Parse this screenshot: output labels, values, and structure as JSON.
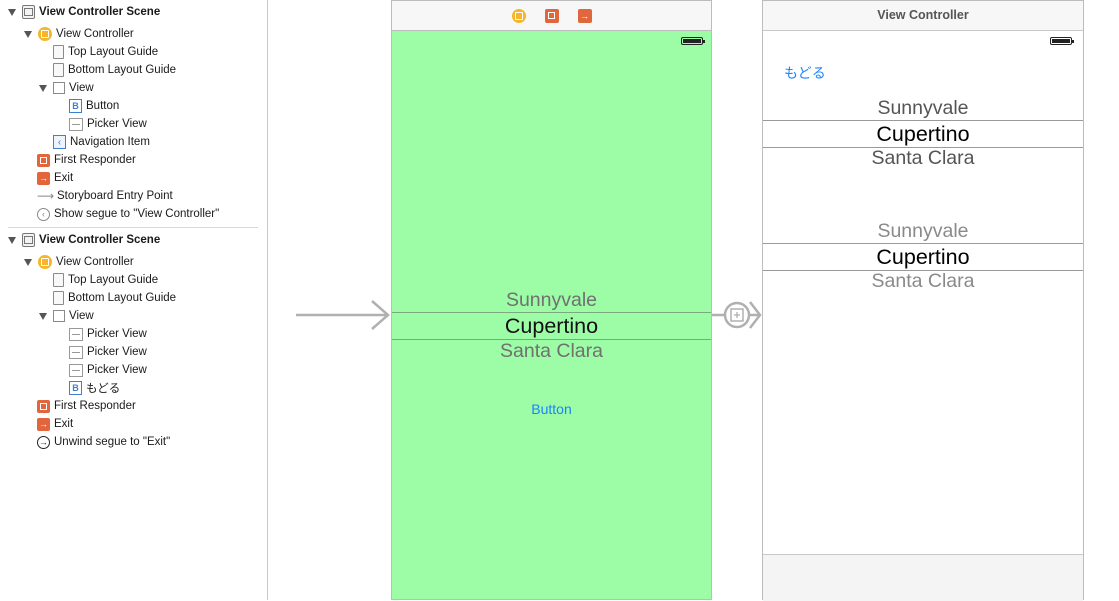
{
  "outline": {
    "scene1": {
      "title": "View Controller Scene",
      "view_controller": "View Controller",
      "top_layout_guide": "Top Layout Guide",
      "bottom_layout_guide": "Bottom Layout Guide",
      "view": "View",
      "button": "Button",
      "picker_view": "Picker View",
      "navigation_item": "Navigation Item",
      "first_responder": "First Responder",
      "exit": "Exit",
      "entry_point": "Storyboard Entry Point",
      "segue": "Show segue to \"View Controller\""
    },
    "scene2": {
      "title": "View Controller Scene",
      "view_controller": "View Controller",
      "top_layout_guide": "Top Layout Guide",
      "bottom_layout_guide": "Bottom Layout Guide",
      "view": "View",
      "picker_view_1": "Picker View",
      "picker_view_2": "Picker View",
      "picker_view_3": "Picker View",
      "back_button": "もどる",
      "first_responder": "First Responder",
      "exit": "Exit",
      "unwind_segue": "Unwind segue to \"Exit\""
    }
  },
  "canvas": {
    "scene1": {
      "background_color": "#9dfca6",
      "picker": {
        "above": "Sunnyvale",
        "selected": "Cupertino",
        "below": "Santa Clara"
      },
      "button_label": "Button"
    },
    "scene2": {
      "title": "View Controller",
      "back_button": "もどる",
      "picker1": {
        "above": "Sunnyvale",
        "selected": "Cupertino",
        "below": "Santa Clara"
      },
      "picker2": {
        "above": "Sunnyvale",
        "selected": "Cupertino",
        "below": "Santa Clara"
      }
    },
    "colors": {
      "tint": "#1a83ff",
      "vc_icon": "#f6b52a",
      "exit_icon": "#e2663c"
    }
  }
}
